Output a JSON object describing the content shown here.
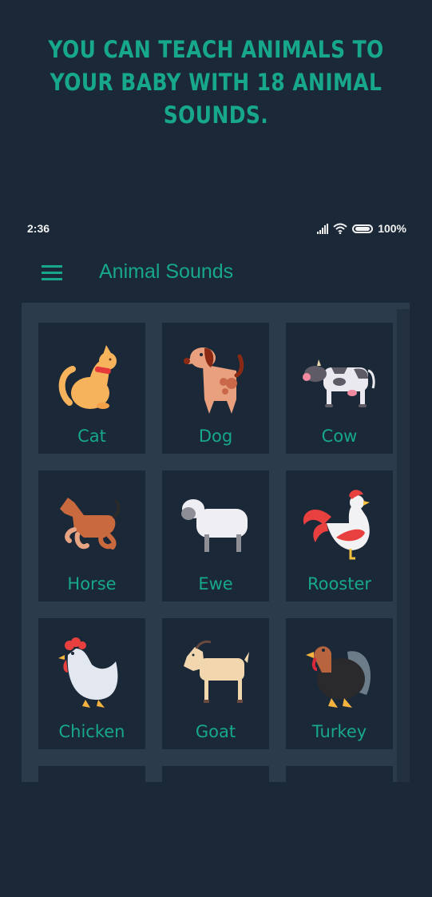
{
  "promo": {
    "lines": [
      "YOU CAN TEACH ANIMALS TO",
      "YOUR BABY WITH 18 ANIMAL",
      "SOUNDS."
    ]
  },
  "status_bar": {
    "time": "2:36",
    "icons": [
      "signal-icon",
      "wifi-icon",
      "battery-icon"
    ],
    "battery": "100%"
  },
  "app_bar": {
    "menu_icon": "hamburger-menu-icon",
    "title": "Animal Sounds"
  },
  "colors": {
    "accent": "#17a88c",
    "background": "#1b2838",
    "panel": "#2b3b4c"
  },
  "animals": [
    {
      "label": "Cat",
      "icon": "cat-icon"
    },
    {
      "label": "Dog",
      "icon": "dog-icon"
    },
    {
      "label": "Cow",
      "icon": "cow-icon"
    },
    {
      "label": "Horse",
      "icon": "horse-icon"
    },
    {
      "label": "Ewe",
      "icon": "sheep-icon"
    },
    {
      "label": "Rooster",
      "icon": "rooster-icon"
    },
    {
      "label": "Chicken",
      "icon": "chicken-icon"
    },
    {
      "label": "Goat",
      "icon": "goat-icon"
    },
    {
      "label": "Turkey",
      "icon": "turkey-icon"
    }
  ]
}
